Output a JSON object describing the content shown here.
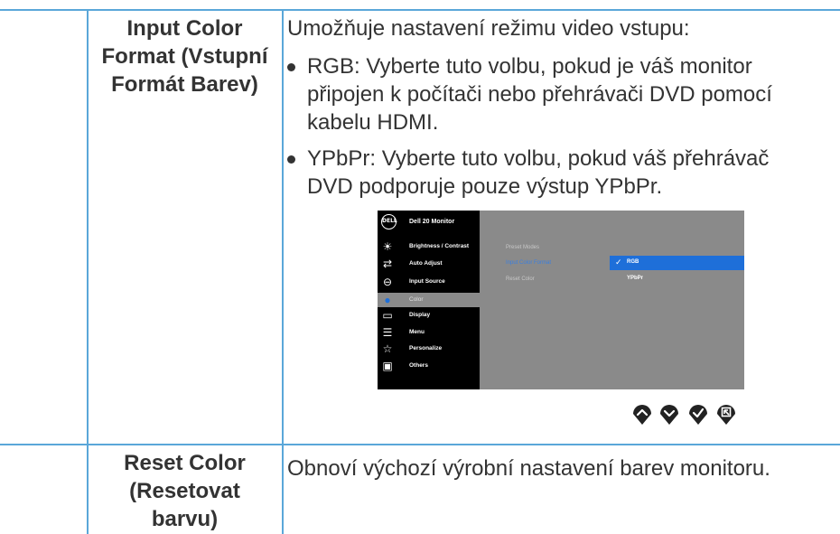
{
  "rows": [
    {
      "label_lines": [
        "Input Color",
        "Format (Vstupní",
        "Formát Barev)"
      ],
      "description": "Umožňuje nastavení režimu video vstupu:",
      "bullets": [
        {
          "lines": [
            "RGB: Vyberte tuto volbu, pokud je váš monitor",
            "připojen k počítači nebo přehrávači DVD pomocí",
            "kabelu HDMI."
          ]
        },
        {
          "lines": [
            "YPbPr: Vyberte tuto volbu, pokud váš přehrávač",
            "DVD podporuje pouze výstup YPbPr."
          ]
        }
      ]
    },
    {
      "label_lines": [
        "Reset Color",
        "(Resetovat",
        "barvu)"
      ],
      "description": "Obnoví výchozí výrobní nastavení barev monitoru."
    }
  ],
  "osd": {
    "logo": "DELL",
    "title": "Dell 20 Monitor",
    "menu": [
      {
        "icon": "brightness-icon",
        "glyph": "☀",
        "label": "Brightness / Contrast"
      },
      {
        "icon": "auto-adjust-icon",
        "glyph": "⇄",
        "label": "Auto Adjust"
      },
      {
        "icon": "input-source-icon",
        "glyph": "⊖",
        "label": "Input Source"
      },
      {
        "icon": "color-icon",
        "glyph": "●",
        "label": "Color"
      },
      {
        "icon": "display-icon",
        "glyph": "▭",
        "label": "Display"
      },
      {
        "icon": "menu-icon",
        "glyph": "☰",
        "label": "Menu"
      },
      {
        "icon": "personalize-icon",
        "glyph": "☆",
        "label": "Personalize"
      },
      {
        "icon": "others-icon",
        "glyph": "▣",
        "label": "Others"
      }
    ],
    "active_menu": "Color",
    "settings": [
      "Preset Modes",
      "Input Color Format",
      "Reset Color"
    ],
    "active_setting": "Input Color Format",
    "options": [
      "RGB",
      "YPbPr"
    ],
    "selected_option": "RGB",
    "nav_buttons": [
      "up-button-icon",
      "down-button-icon",
      "ok-button-icon",
      "back-button-icon"
    ]
  },
  "colors": {
    "rule": "#5aa7d9",
    "text": "#333333",
    "osd_accent": "#1e6fd9",
    "osd_panel": "#8a8a8a"
  }
}
